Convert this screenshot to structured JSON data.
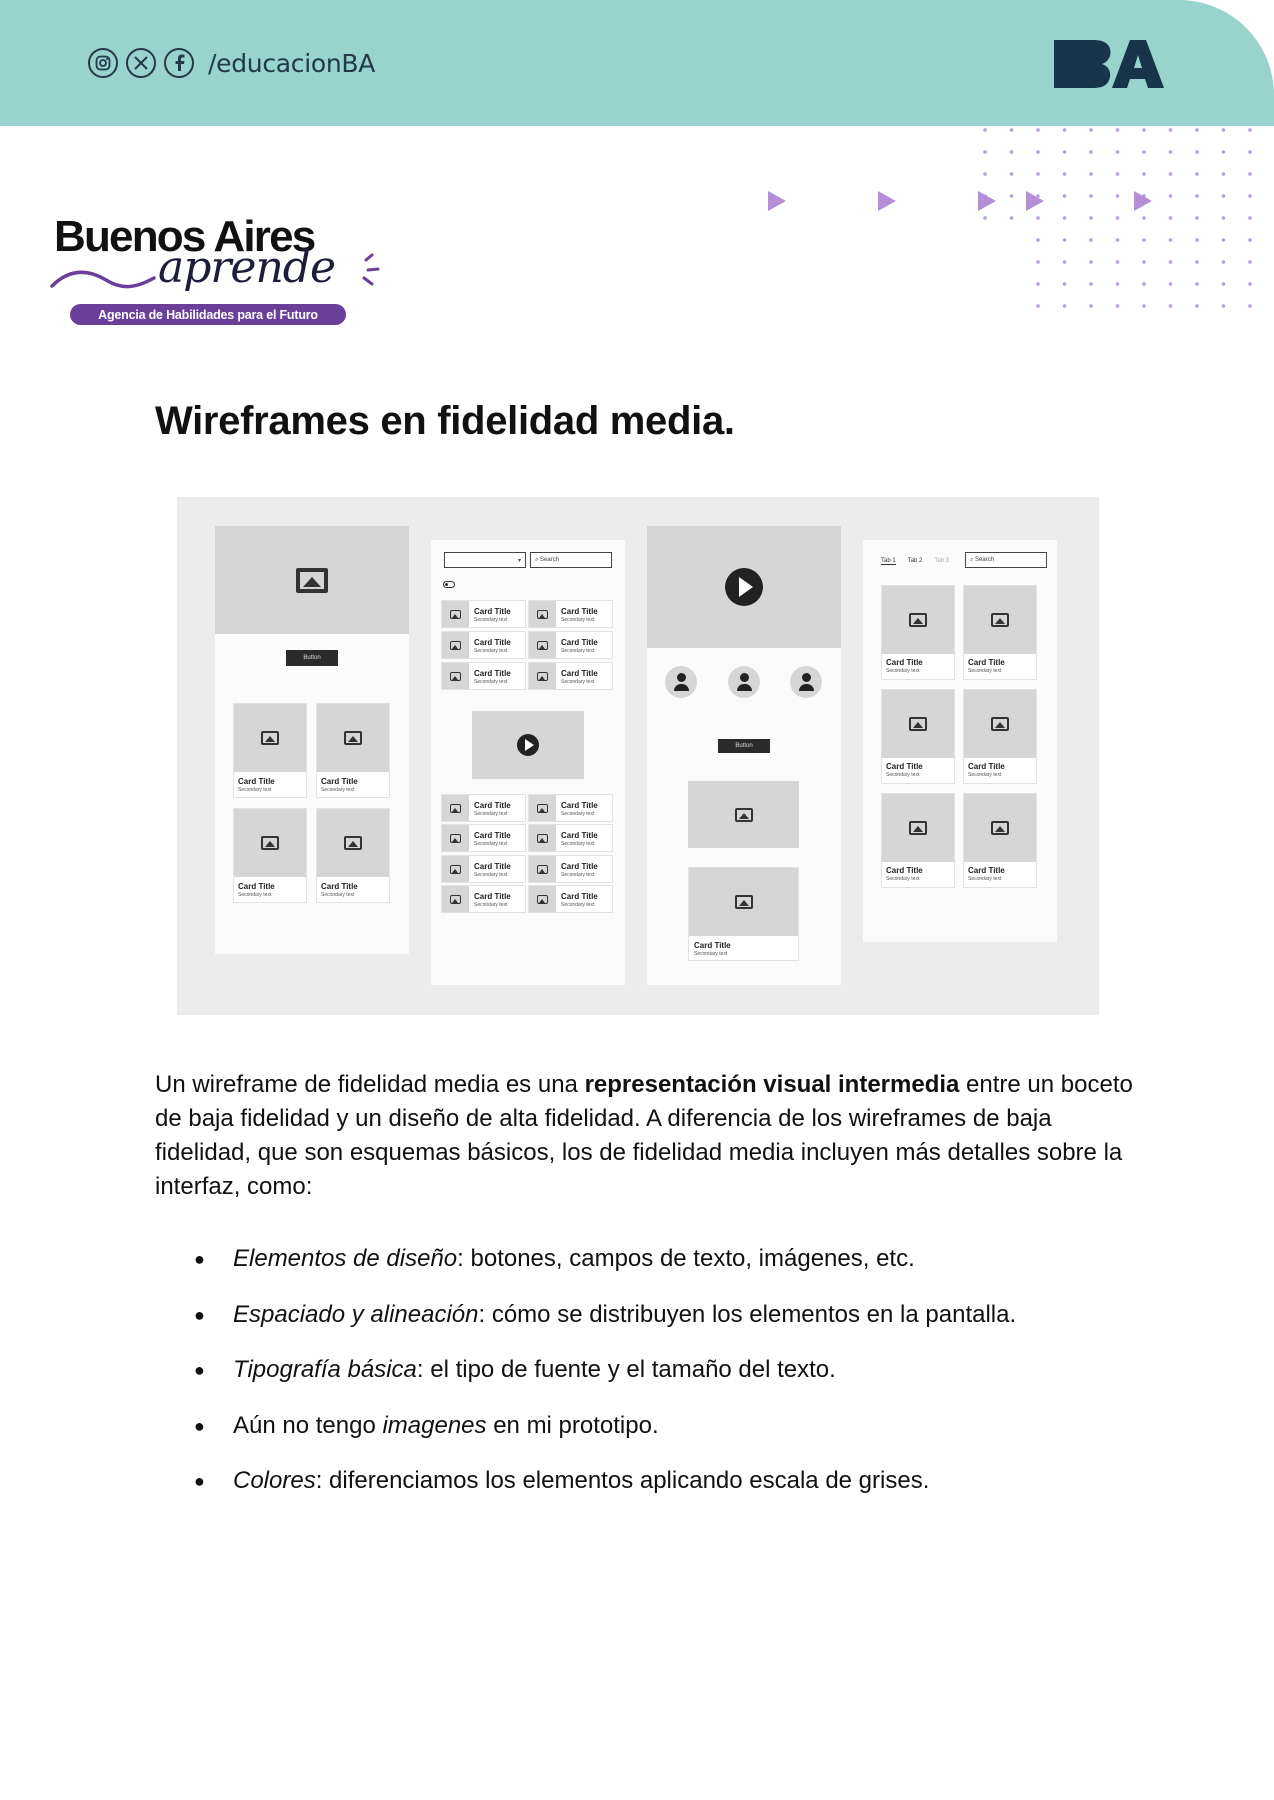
{
  "header": {
    "social_icons": [
      "instagram-icon",
      "x-icon",
      "facebook-icon"
    ],
    "handle": "/educacionBA",
    "logo": "BA",
    "band_color": "#98d3cd"
  },
  "brand": {
    "name": "Buenos Aires",
    "script": "aprende",
    "tagline": "Agencia de Habilidades para el Futuro",
    "accent": "#6a3f9a"
  },
  "title": "Wireframes en fidelidad media.",
  "wireframe": {
    "button": "Button",
    "card_title": "Card Title",
    "card_secondary": "Secondary text",
    "search": "Search",
    "tabs": [
      "Tab 1",
      "Tab 2",
      "Tab 3"
    ]
  },
  "intro": {
    "before": "Un wireframe de fidelidad media es una ",
    "bold": "representación visual intermedia",
    "after": " entre un boceto de baja fidelidad y un diseño de alta fidelidad. A diferencia de los wireframes de baja fidelidad, que son esquemas básicos, los de fidelidad media incluyen más detalles sobre la interfaz, como:"
  },
  "bullets": [
    {
      "pre": "",
      "em": "Elementos de diseño",
      "post": ": botones, campos de texto, imágenes, etc."
    },
    {
      "pre": "",
      "em": "Espaciado y alineación",
      "post": ": cómo se distribuyen los elementos en la pantalla."
    },
    {
      "pre": "",
      "em": "Tipografía básica",
      "post": ": el tipo de fuente y el tamaño del texto."
    },
    {
      "pre": "Aún no tengo ",
      "em": "imagenes",
      "post": " en mi prototipo."
    },
    {
      "pre": "",
      "em": "Colores",
      "post": ": diferenciamos los elementos aplicando escala de grises."
    }
  ]
}
